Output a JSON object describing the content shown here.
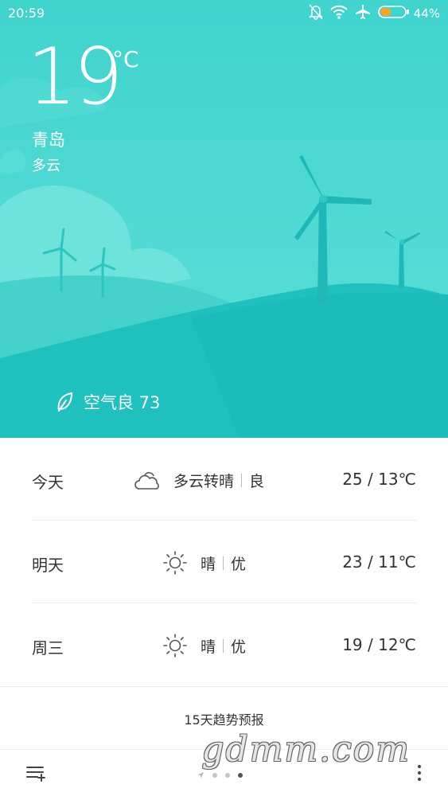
{
  "status_bar": {
    "time": "20:59",
    "battery_percent": "44%",
    "battery_level": 0.44,
    "icons": [
      "mute-bell-icon",
      "wifi-icon",
      "airplane-icon",
      "battery-icon"
    ]
  },
  "current": {
    "temperature": "19",
    "unit": "°C",
    "city": "青岛",
    "condition": "多云",
    "air_quality": "空气良 73"
  },
  "forecast": [
    {
      "day": "今天",
      "icon": "cloudy-icon",
      "condition": "多云转晴",
      "aqi": "良",
      "range": "25 / 13℃"
    },
    {
      "day": "明天",
      "icon": "sunny-icon",
      "condition": "晴",
      "aqi": "优",
      "range": "23 / 11℃"
    },
    {
      "day": "周三",
      "icon": "sunny-icon",
      "condition": "晴",
      "aqi": "优",
      "range": "19 / 12℃"
    }
  ],
  "trend_link": "15天趋势预报",
  "page_indicator": {
    "count": 3,
    "active": 3
  },
  "watermark": "gdmm.com",
  "colors": {
    "sky_top": "#3fd3cc",
    "sky_bottom": "#1cbfbf",
    "text": "#333333"
  }
}
